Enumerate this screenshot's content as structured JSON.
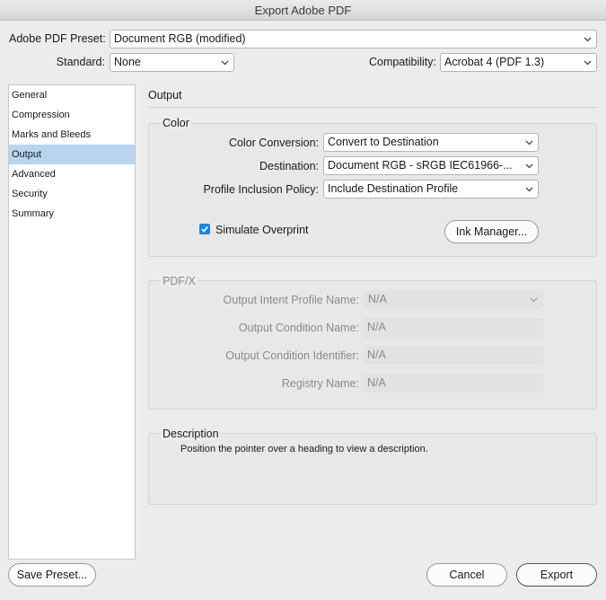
{
  "window": {
    "title": "Export Adobe PDF"
  },
  "preset": {
    "label": "Adobe PDF Preset:",
    "value": "Document RGB (modified)"
  },
  "standard": {
    "label": "Standard:",
    "value": "None"
  },
  "compatibility": {
    "label": "Compatibility:",
    "value": "Acrobat 4 (PDF 1.3)"
  },
  "sidebar": {
    "items": [
      {
        "label": "General"
      },
      {
        "label": "Compression"
      },
      {
        "label": "Marks and Bleeds"
      },
      {
        "label": "Output",
        "selected": true
      },
      {
        "label": "Advanced"
      },
      {
        "label": "Security"
      },
      {
        "label": "Summary"
      }
    ]
  },
  "panel": {
    "title": "Output"
  },
  "color": {
    "title": "Color",
    "conversion_label": "Color Conversion:",
    "conversion_value": "Convert to Destination",
    "destination_label": "Destination:",
    "destination_value": "Document RGB - sRGB IEC61966-...",
    "policy_label": "Profile Inclusion Policy:",
    "policy_value": "Include Destination Profile",
    "simulate_label": "Simulate Overprint",
    "simulate_checked": true,
    "ink_manager_label": "Ink Manager..."
  },
  "pdfx": {
    "title": "PDF/X",
    "intent_label": "Output Intent Profile Name:",
    "intent_value": "N/A",
    "condition_name_label": "Output Condition Name:",
    "condition_name_value": "N/A",
    "condition_id_label": "Output Condition Identifier:",
    "condition_id_value": "N/A",
    "registry_label": "Registry Name:",
    "registry_value": "N/A"
  },
  "description": {
    "title": "Description",
    "text": "Position the pointer over a heading to view a description."
  },
  "footer": {
    "save_preset": "Save Preset...",
    "cancel": "Cancel",
    "export": "Export"
  },
  "colors": {
    "selection": "#b8d4ef",
    "checkbox": "#1e84e3"
  }
}
